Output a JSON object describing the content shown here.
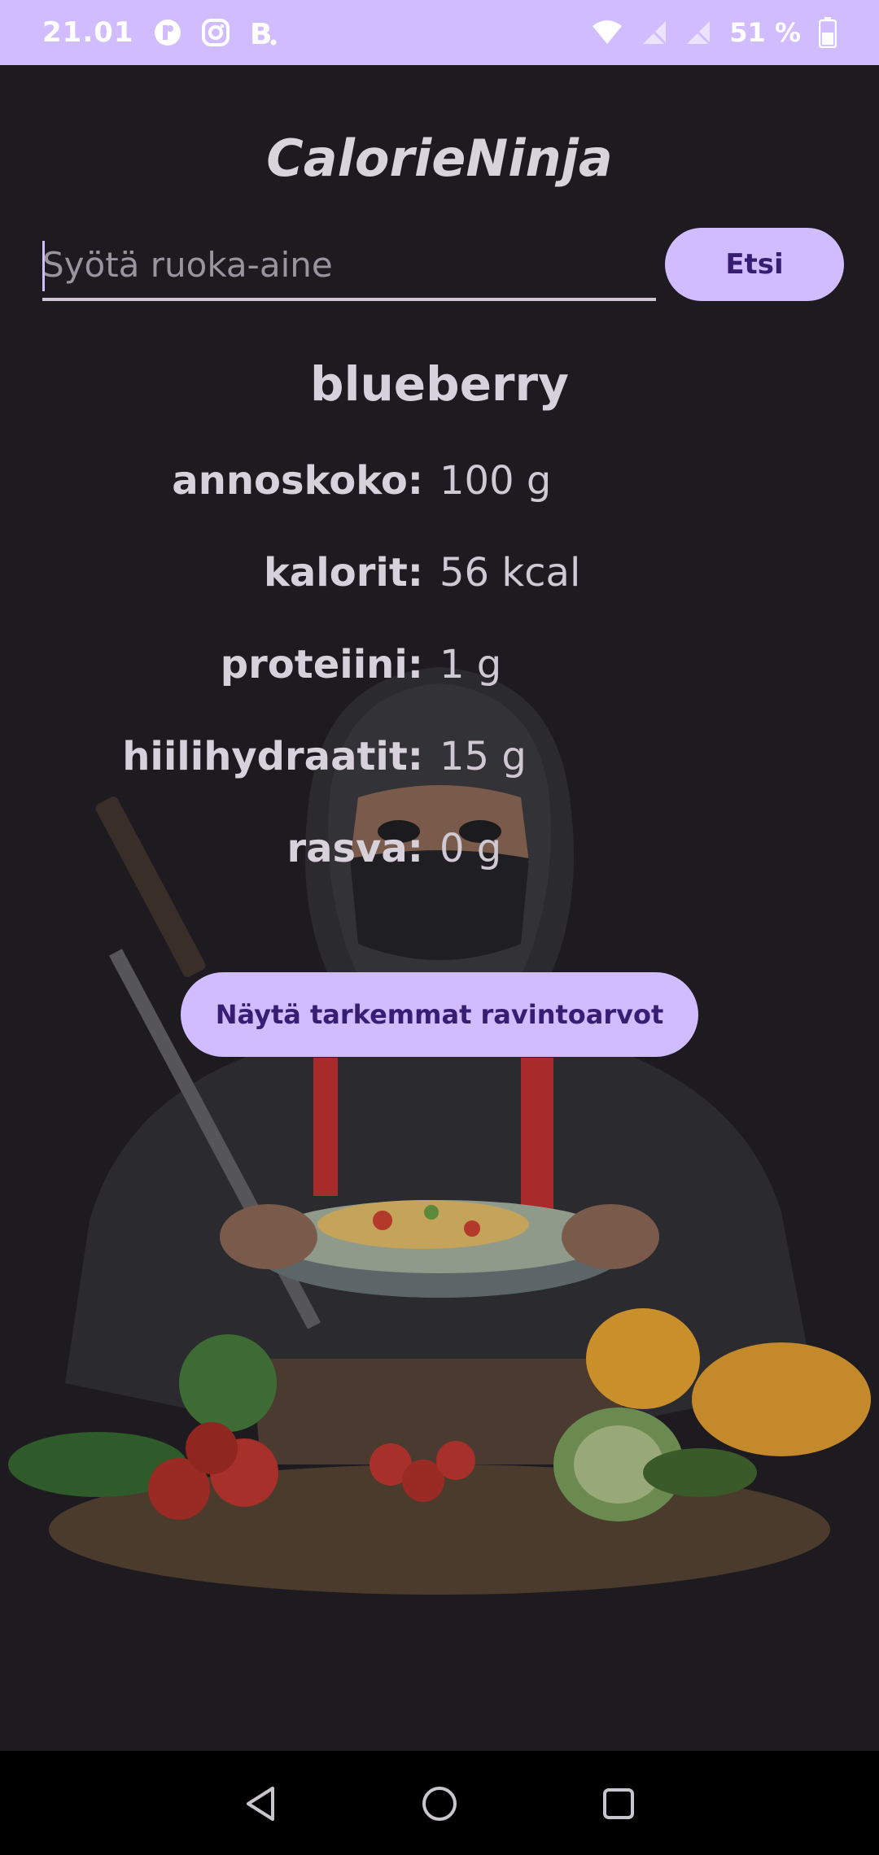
{
  "status_bar": {
    "time": "21.01",
    "battery_text": "51 %",
    "left_icons": [
      "notification-app-icon",
      "instagram-icon",
      "booking-b-icon"
    ],
    "right_icons": [
      "wifi-icon",
      "no-signal-icon",
      "no-signal-icon-2",
      "battery-icon"
    ]
  },
  "app": {
    "title": "CalorieNinja"
  },
  "search": {
    "value": "",
    "placeholder": "Syötä ruoka-aine",
    "button_label": "Etsi"
  },
  "result": {
    "food_name": "blueberry",
    "nutrients": [
      {
        "label": "annoskoko:",
        "value": "100 g"
      },
      {
        "label": "kalorit:",
        "value": "56 kcal"
      },
      {
        "label": "proteiini:",
        "value": "1 g"
      },
      {
        "label": "hiilihydraatit:",
        "value": "15 g"
      },
      {
        "label": "rasva:",
        "value": "0 g"
      }
    ],
    "details_button_label": "Näytä tarkemmat ravintoarvot"
  },
  "navigation": {
    "icons": [
      "back-icon",
      "home-icon",
      "recents-icon"
    ]
  },
  "colors": {
    "accent": "#d0bcff",
    "on_accent": "#381e72",
    "background": "#1d1b20"
  }
}
